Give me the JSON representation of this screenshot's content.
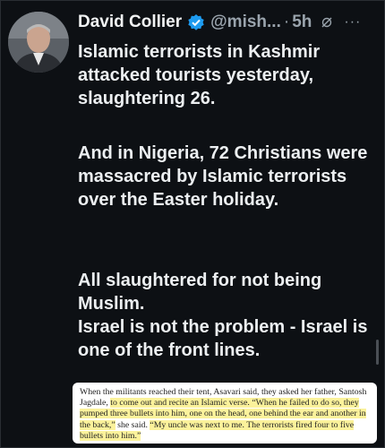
{
  "author": {
    "name": "David Collier",
    "handle": "@mish...",
    "separator": "·",
    "time": "5h",
    "more": "···"
  },
  "icons": {
    "verified": "verified-badge-icon",
    "grok": "grok-icon",
    "more": "more-icon",
    "avatar": "avatar-photo"
  },
  "colors": {
    "verified": "#1d9bf0",
    "highlight": "#fbf29b",
    "background": "#0d1014"
  },
  "post": {
    "paragraph1": "Islamic terrorists in Kashmir attacked tourists yesterday, slaughtering 26.",
    "paragraph2": "And in Nigeria, 72 Christians were massacred by Islamic terrorists over the Easter holiday.",
    "paragraph3_line1": "All slaughtered for not being Muslim.",
    "paragraph3_line2": "Israel is not the problem - Israel is one of the front lines."
  },
  "quote": {
    "plain1": "When the militants reached their tent, Asavari said, they asked her father, Santosh Jagdale, ",
    "hl1": "to come out and recite an Islamic verse. “When he failed to do so, they pumped three bullets into him, one on the head, one behind the ear and another in the back,”",
    "plain2": " she said. ",
    "hl2": "“My uncle was next to me. The terrorists fired four to five bullets into him.”"
  }
}
